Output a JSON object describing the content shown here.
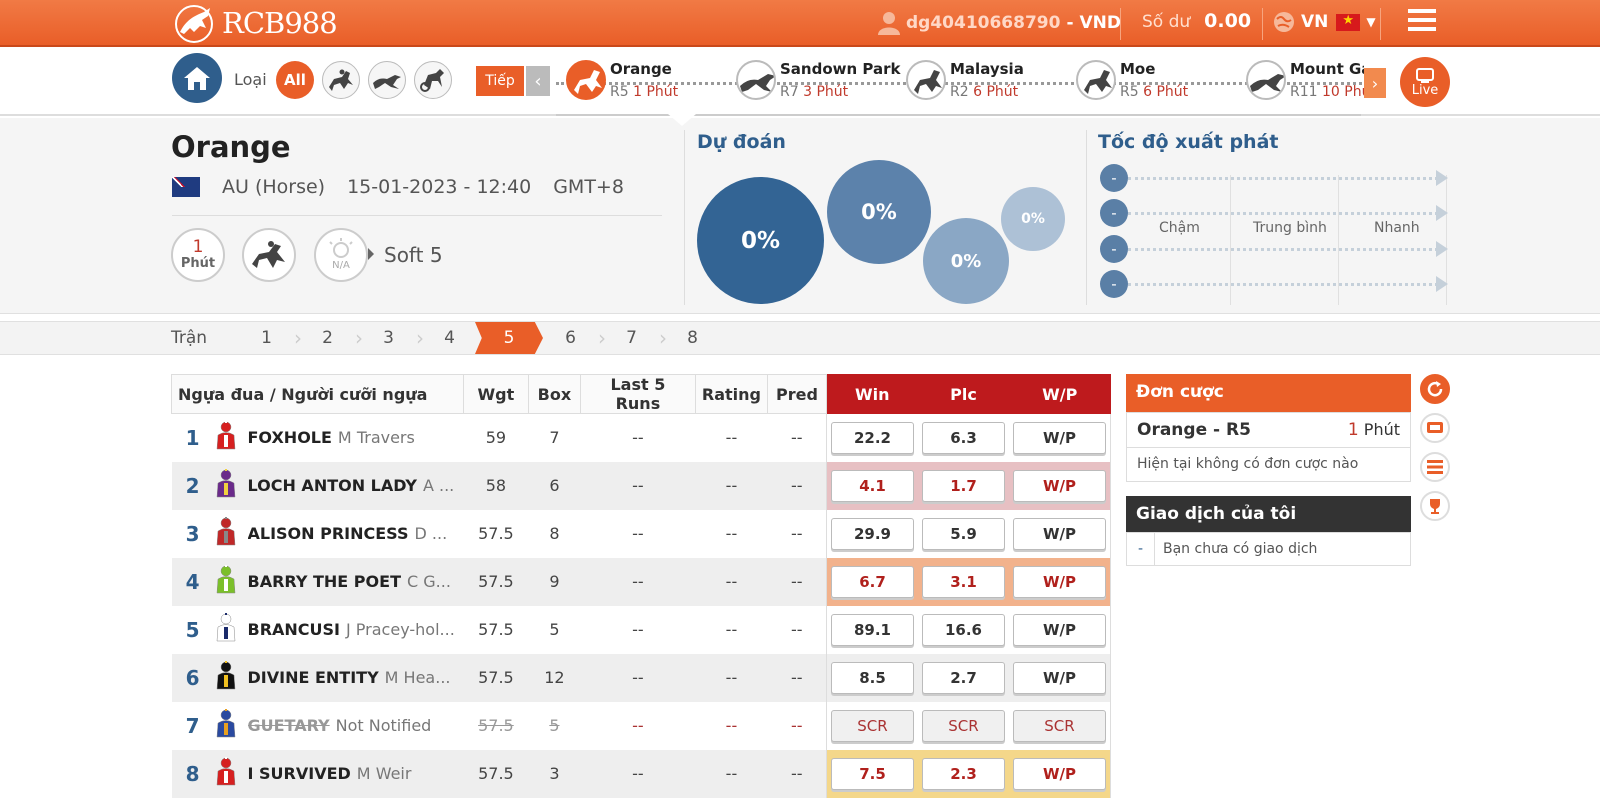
{
  "header": {
    "brand": "RCB988",
    "username": "dg40410668790",
    "currency_sep": "-",
    "currency": "VND",
    "balance_label": "Số dư",
    "balance_value": "0.00",
    "language": "VN"
  },
  "racebar": {
    "type_label": "Loại",
    "all_label": "All",
    "next_label": "Tiếp",
    "live_label": "Live",
    "races": [
      {
        "name": "Orange",
        "code": "R5",
        "time": "1 Phút",
        "icon": "horse-icon",
        "active": true
      },
      {
        "name": "Sandown Park",
        "code": "R7",
        "time": "3 Phút",
        "icon": "greyhound-icon"
      },
      {
        "name": "Malaysia",
        "code": "R2",
        "time": "6 Phút",
        "icon": "horse-icon"
      },
      {
        "name": "Moe",
        "code": "R5",
        "time": "6 Phút",
        "icon": "horse-icon"
      },
      {
        "name": "Mount Ga",
        "code": "R11",
        "time": "10 Phú",
        "icon": "greyhound-icon"
      }
    ]
  },
  "race_info": {
    "name": "Orange",
    "region": "AU (Horse)",
    "datetime": "15-01-2023 - 12:40",
    "timezone": "GMT+8",
    "minutes": "1",
    "minutes_label": "Phút",
    "weather": "N/A",
    "track": "Soft 5"
  },
  "prediction": {
    "title": "Dự đoán",
    "bubbles": [
      "0%",
      "0%",
      "0%",
      "0%"
    ]
  },
  "start_speed": {
    "title": "Tốc độ xuất phát",
    "rows": [
      "-",
      "-",
      "-",
      "-"
    ],
    "labels": [
      "Chậm",
      "Trung bình",
      "Nhanh"
    ]
  },
  "tran": {
    "label": "Trận",
    "items": [
      "1",
      "2",
      "3",
      "4",
      "5",
      "6",
      "7",
      "8"
    ],
    "active": "5"
  },
  "table": {
    "headers": [
      "Ngựa đua / Người cưỡi ngựa",
      "Wgt",
      "Box",
      "Last 5 Runs",
      "Rating",
      "Pred",
      "Win",
      "Plc",
      "W/P"
    ],
    "rows": [
      {
        "no": "1",
        "horse": "FOXHOLE",
        "jockey": "M Travers",
        "wgt": "59",
        "box": "7",
        "last5": "--",
        "rating": "--",
        "pred": "--",
        "win": "22.2",
        "plc": "6.3",
        "wp": "W/P",
        "silk": "#d62020",
        "silk2": "#ffffff"
      },
      {
        "no": "2",
        "horse": "LOCH ANTON LADY",
        "jockey": "A ...",
        "wgt": "58",
        "box": "6",
        "last5": "--",
        "rating": "--",
        "pred": "--",
        "win": "4.1",
        "plc": "1.7",
        "wp": "W/P",
        "silk": "#6a2a8a",
        "silk2": "#f0d040"
      },
      {
        "no": "3",
        "horse": "ALISON PRINCESS",
        "jockey": "D ...",
        "wgt": "57.5",
        "box": "8",
        "last5": "--",
        "rating": "--",
        "pred": "--",
        "win": "29.9",
        "plc": "5.9",
        "wp": "W/P",
        "silk": "#c02828",
        "silk2": "#888888"
      },
      {
        "no": "4",
        "horse": "BARRY THE POET",
        "jockey": "C G...",
        "wgt": "57.5",
        "box": "9",
        "last5": "--",
        "rating": "--",
        "pred": "--",
        "win": "6.7",
        "plc": "3.1",
        "wp": "W/P",
        "silk": "#7bbf2a",
        "silk2": "#ffffff"
      },
      {
        "no": "5",
        "horse": "BRANCUSI",
        "jockey": "J Pracey-hol...",
        "wgt": "57.5",
        "box": "5",
        "last5": "--",
        "rating": "--",
        "pred": "--",
        "win": "89.1",
        "plc": "16.6",
        "wp": "W/P",
        "silk": "#ffffff",
        "silk2": "#1a2a6a"
      },
      {
        "no": "6",
        "horse": "DIVINE ENTITY",
        "jockey": "M Hea...",
        "wgt": "57.5",
        "box": "12",
        "last5": "--",
        "rating": "--",
        "pred": "--",
        "win": "8.5",
        "plc": "2.7",
        "wp": "W/P",
        "silk": "#111111",
        "silk2": "#f0c020"
      },
      {
        "no": "7",
        "horse": "GUETARY",
        "jockey": "Not Notified",
        "wgt": "57.5",
        "box": "5",
        "last5": "--",
        "rating": "--",
        "pred": "--",
        "win": "SCR",
        "plc": "SCR",
        "wp": "SCR",
        "silk": "#2a4aa0",
        "silk2": "#e8a020"
      },
      {
        "no": "8",
        "horse": "I SURVIVED",
        "jockey": "M Weir",
        "wgt": "57.5",
        "box": "3",
        "last5": "--",
        "rating": "--",
        "pred": "--",
        "win": "7.5",
        "plc": "2.3",
        "wp": "W/P",
        "silk": "#d62020",
        "silk2": "#ffffff"
      }
    ]
  },
  "bet_slip": {
    "title": "Đơn cược",
    "race": "Orange - R5",
    "minutes": "1",
    "minutes_label": "Phút",
    "empty": "Hiện tại không có đơn cược nào"
  },
  "my_trades": {
    "title": "Giao dịch của tôi",
    "dash": "-",
    "empty": "Bạn chưa có giao dịch"
  },
  "colors": {
    "accent": "#e95e28",
    "navy": "#2f5e8c",
    "odds_red": "#be1a1d"
  }
}
